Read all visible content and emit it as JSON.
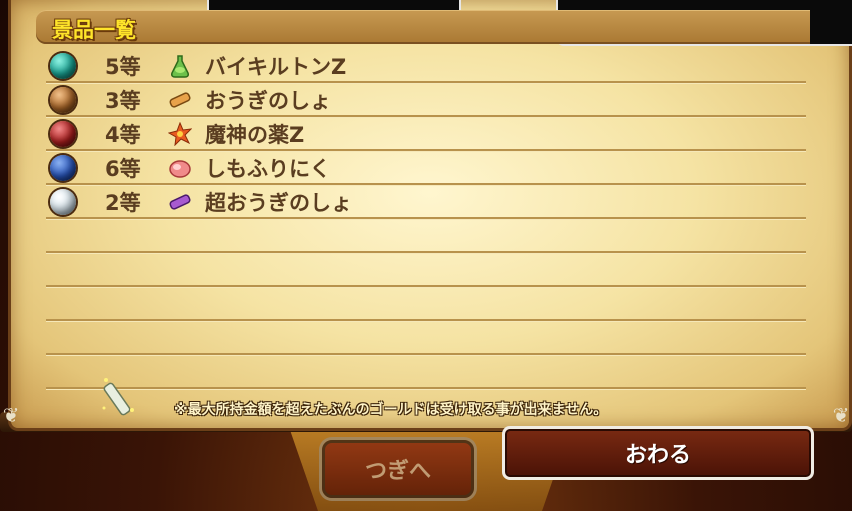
{
  "panel": {
    "title": "景品一覧"
  },
  "prizes": [
    {
      "rank": "5等",
      "name": "バイキルトンZ",
      "orb_color": "#1aa898",
      "icon": "flask-icon"
    },
    {
      "rank": "3等",
      "name": "おうぎのしょ",
      "orb_color": "#b06a2a",
      "icon": "scroll-icon"
    },
    {
      "rank": "4等",
      "name": "魔神の薬Z",
      "orb_color": "#b02020",
      "icon": "star-burst-icon"
    },
    {
      "rank": "6等",
      "name": "しもふりにく",
      "orb_color": "#2a58c0",
      "icon": "meat-icon"
    },
    {
      "rank": "2等",
      "name": "超おうぎのしょ",
      "orb_color": "#d8e6ee",
      "icon": "purple-scroll-icon"
    }
  ],
  "notice": "※最大所持金額を超えたぶんのゴールドは受け取る事が出来ません。",
  "buttons": {
    "next": "つぎへ",
    "close": "おわる"
  },
  "colors": {
    "title_text": "#ffe52a",
    "item_text": "#5a3d20",
    "parchment": "#f5e3a3"
  }
}
